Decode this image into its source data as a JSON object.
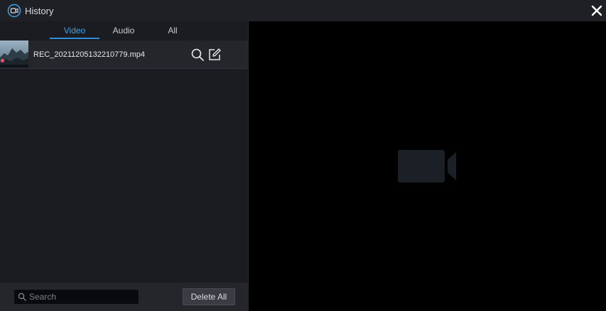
{
  "window": {
    "title": "History",
    "app_icon": "video-recorder-icon",
    "close_icon": "close-icon"
  },
  "tabs": [
    {
      "label": "Video",
      "active": true
    },
    {
      "label": "Audio",
      "active": false
    },
    {
      "label": "All",
      "active": false
    }
  ],
  "files": [
    {
      "name": "REC_20211205132210779.mp4",
      "is_new": true,
      "actions": [
        "search-icon",
        "edit-icon"
      ]
    }
  ],
  "footer": {
    "search_placeholder": "Search",
    "delete_all_label": "Delete All"
  },
  "preview": {
    "placeholder_icon": "video-camera-icon"
  },
  "colors": {
    "accent": "#2e8fd8",
    "new_indicator": "#ff4b5b",
    "panel_bg": "#1b1c21",
    "titlebar_bg": "#1f2026"
  }
}
